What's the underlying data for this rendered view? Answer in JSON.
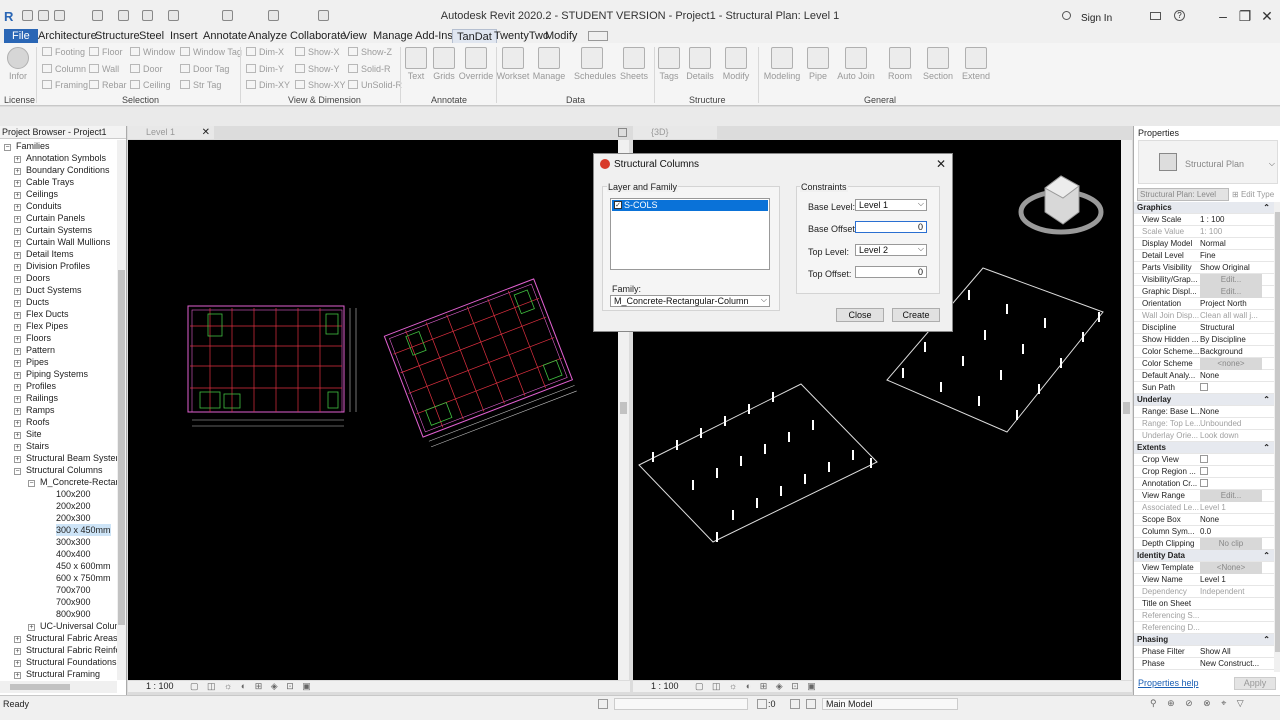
{
  "title_bar": {
    "title": "Autodesk Revit 2020.2 - STUDENT VERSION - Project1 - Structural Plan: Level 1",
    "sign_in": "Sign In"
  },
  "menu_tabs": [
    "File",
    "Architecture",
    "Structure",
    "Steel",
    "Insert",
    "Annotate",
    "Analyze",
    "Collaborate",
    "View",
    "Manage",
    "Add-Ins",
    "TanDat",
    "TwentyTwo",
    "Modify"
  ],
  "active_tab": "TanDat",
  "ribbon": {
    "info_label": "Infor",
    "selection_col1": [
      "Footing",
      "Column",
      "Framing"
    ],
    "selection_col2": [
      "Floor",
      "Wall",
      "Rebar"
    ],
    "selection_col3": [
      "Window",
      "Door",
      "Ceiling"
    ],
    "selection_col4": [
      "Window Tag",
      "Door Tag",
      "Str Tag"
    ],
    "dim_col1": [
      "Dim-X",
      "Dim-Y",
      "Dim-XY"
    ],
    "dim_col2": [
      "Show-X",
      "Show-Y",
      "Show-XY"
    ],
    "dim_col3": [
      "Show-Z",
      "Solid-R",
      "UnSolid-R"
    ],
    "annotate_buttons": [
      "Text",
      "Grids",
      "Override"
    ],
    "data_buttons": [
      "Workset",
      "Manage",
      "Schedules",
      "Sheets"
    ],
    "structure_buttons": [
      "Tags",
      "Details",
      "Modify"
    ],
    "general_buttons": [
      "Modeling",
      "Pipe",
      "Auto Join",
      "Room",
      "Section",
      "Extend"
    ],
    "panels": [
      "License",
      "Selection",
      "View & Dimension",
      "Annotate",
      "Data",
      "Structure",
      "General"
    ]
  },
  "project_browser": {
    "header": "Project Browser - Project1",
    "root": "Families",
    "items": [
      "Annotation Symbols",
      "Boundary Conditions",
      "Cable Trays",
      "Ceilings",
      "Conduits",
      "Curtain Panels",
      "Curtain Systems",
      "Curtain Wall Mullions",
      "Detail Items",
      "Division Profiles",
      "Doors",
      "Duct Systems",
      "Ducts",
      "Flex Ducts",
      "Flex Pipes",
      "Floors",
      "Pattern",
      "Pipes",
      "Piping Systems",
      "Profiles",
      "Railings",
      "Ramps",
      "Roofs",
      "Site",
      "Stairs",
      "Structural Beam System",
      "Structural Columns"
    ],
    "family": "M_Concrete-Rectan",
    "types": [
      "100x200",
      "200x200",
      "200x300",
      "300 x 450mm",
      "300x300",
      "400x400",
      "450 x 600mm",
      "600 x 750mm",
      "700x700",
      "700x900",
      "800x900"
    ],
    "selected_type": "300 x 450mm",
    "after": [
      "UC-Universal Colum"
    ],
    "more": [
      "Structural Fabric Areas",
      "Structural Fabric Reinfor",
      "Structural Foundations",
      "Structural Framing"
    ]
  },
  "views": {
    "left_tab": "Level 1",
    "right_tab": "{3D}",
    "left_scale": "1 : 100",
    "right_scale": "1 : 100"
  },
  "dialog": {
    "title": "Structural Columns",
    "layer_group": "Layer and Family",
    "layer_item": "S-COLS",
    "family_label": "Family:",
    "family_value": "M_Concrete-Rectangular-Column",
    "constraints_group": "Constraints",
    "base_level_label": "Base Level:",
    "base_level_value": "Level 1",
    "base_offset_label": "Base Offset:",
    "base_offset_value": "0",
    "top_level_label": "Top Level:",
    "top_level_value": "Level 2",
    "top_offset_label": "Top Offset:",
    "top_offset_value": "0",
    "close_label": "Close",
    "create_label": "Create"
  },
  "properties": {
    "header": "Properties",
    "type_name": "Structural Plan",
    "selector": "Structural Plan: Level",
    "edit_type": "Edit Type",
    "rows": [
      {
        "k": "Graphics",
        "cat": true
      },
      {
        "k": "View Scale",
        "v": "1 : 100"
      },
      {
        "k": "Scale Value",
        "v": "1:  100",
        "grey": true
      },
      {
        "k": "Display Model",
        "v": "Normal"
      },
      {
        "k": "Detail Level",
        "v": "Fine"
      },
      {
        "k": "Parts Visibility",
        "v": "Show Original"
      },
      {
        "k": "Visibility/Grap...",
        "v": "Edit...",
        "btn": true
      },
      {
        "k": "Graphic Displ...",
        "v": "Edit...",
        "btn": true
      },
      {
        "k": "Orientation",
        "v": "Project North"
      },
      {
        "k": "Wall Join Disp...",
        "v": "Clean all wall j...",
        "grey": true
      },
      {
        "k": "Discipline",
        "v": "Structural"
      },
      {
        "k": "Show Hidden ...",
        "v": "By Discipline"
      },
      {
        "k": "Color Scheme...",
        "v": "Background"
      },
      {
        "k": "Color Scheme",
        "v": "<none>",
        "btn": true
      },
      {
        "k": "Default Analy...",
        "v": "None"
      },
      {
        "k": "Sun Path",
        "v": "",
        "check": true
      },
      {
        "k": "Underlay",
        "cat": true
      },
      {
        "k": "Range: Base L...",
        "v": "None"
      },
      {
        "k": "Range: Top Le...",
        "v": "Unbounded",
        "grey": true
      },
      {
        "k": "Underlay Orie...",
        "v": "Look down",
        "grey": true
      },
      {
        "k": "Extents",
        "cat": true
      },
      {
        "k": "Crop View",
        "v": "",
        "check": true
      },
      {
        "k": "Crop Region ...",
        "v": "",
        "check": true
      },
      {
        "k": "Annotation Cr...",
        "v": "",
        "check": true
      },
      {
        "k": "View Range",
        "v": "Edit...",
        "btn": true
      },
      {
        "k": "Associated Le...",
        "v": "Level 1",
        "grey": true
      },
      {
        "k": "Scope Box",
        "v": "None"
      },
      {
        "k": "Column Sym...",
        "v": "0.0"
      },
      {
        "k": "Depth Clipping",
        "v": "No clip",
        "btn": true
      },
      {
        "k": "Identity Data",
        "cat": true
      },
      {
        "k": "View Template",
        "v": "<None>",
        "btn": true
      },
      {
        "k": "View Name",
        "v": "Level 1"
      },
      {
        "k": "Dependency",
        "v": "Independent",
        "grey": true
      },
      {
        "k": "Title on Sheet",
        "v": ""
      },
      {
        "k": "Referencing S...",
        "v": "",
        "grey": true
      },
      {
        "k": "Referencing D...",
        "v": "",
        "grey": true
      },
      {
        "k": "Phasing",
        "cat": true
      },
      {
        "k": "Phase Filter",
        "v": "Show All"
      },
      {
        "k": "Phase",
        "v": "New Construct..."
      }
    ],
    "help_link": "Properties help",
    "apply": "Apply"
  },
  "status": {
    "text": "Ready",
    "zero": ":0",
    "model": "Main Model"
  }
}
